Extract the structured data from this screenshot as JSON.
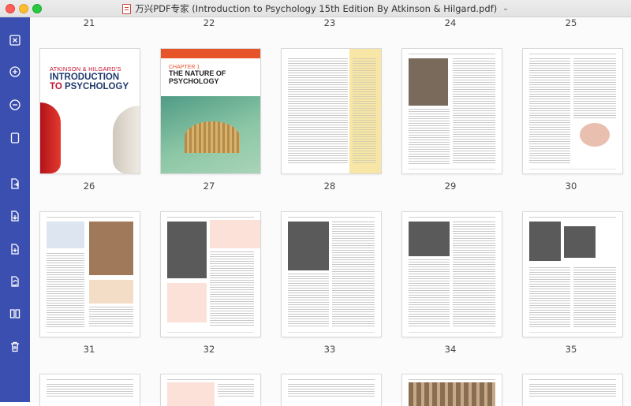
{
  "window": {
    "title": "万兴PDF专家 (Introduction to Psychology 15th Edition By Atkinson & Hilgard.pdf)"
  },
  "sidebar": {
    "tools": [
      {
        "name": "close-pane-icon"
      },
      {
        "name": "zoom-in-icon"
      },
      {
        "name": "zoom-out-icon"
      },
      {
        "name": "blank-page-icon"
      },
      {
        "name": "extract-page-icon"
      },
      {
        "name": "insert-page-icon"
      },
      {
        "name": "add-page-icon"
      },
      {
        "name": "replace-page-icon"
      },
      {
        "name": "split-page-icon"
      },
      {
        "name": "delete-page-icon"
      }
    ]
  },
  "cover": {
    "subtitle": "ATKINSON & HILGARD'S",
    "title_line1": "INTRODUCTION",
    "title_line2_a": "TO",
    "title_line2_b": "PSYCHOLOGY"
  },
  "chapter": {
    "label": "CHAPTER 1",
    "name_line1": "THE NATURE OF",
    "name_line2": "PSYCHOLOGY"
  },
  "pages": {
    "row1": [
      "21",
      "22",
      "23",
      "24",
      "25"
    ],
    "row2": [
      "26",
      "27",
      "28",
      "29",
      "30"
    ],
    "row3": [
      "31",
      "32",
      "33",
      "34",
      "35"
    ]
  },
  "colors": {
    "sidebar": "#3b4fb0",
    "accent_red": "#c8102e",
    "accent_orange": "#e8542a"
  }
}
